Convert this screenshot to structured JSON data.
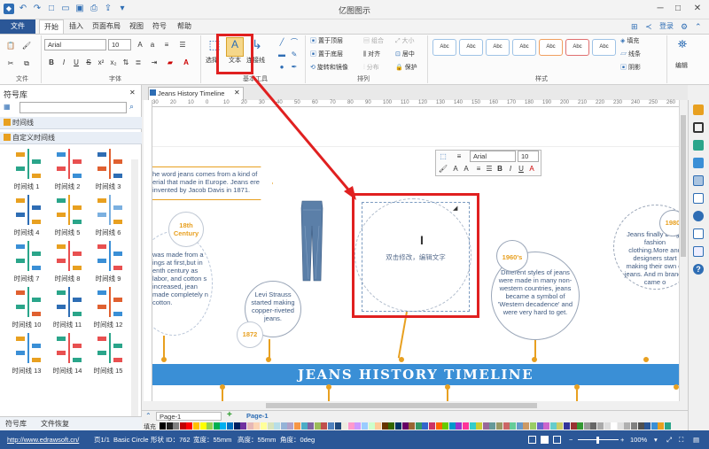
{
  "app": {
    "title": "亿图图示"
  },
  "menu": {
    "file": "文件",
    "tabs": [
      "开始",
      "插入",
      "页面布局",
      "视图",
      "符号",
      "帮助"
    ],
    "login": "登录"
  },
  "ribbon": {
    "font_name": "Arial",
    "font_size": "10",
    "group_file": "文件",
    "group_font": "字体",
    "group_basic": "基本工具",
    "group_arrange": "排列",
    "group_style": "样式",
    "select": "选择",
    "text": "文本",
    "connector": "连接线",
    "bring_front": "置于顶层",
    "send_back": "置于底层",
    "rotate": "旋转和镜像",
    "group": "组合",
    "align": "对齐",
    "distribute": "分布",
    "size": "大小",
    "center": "居中",
    "protect": "保护",
    "fill": "填充",
    "line": "线条",
    "shadow": "阴影",
    "edit": "编辑",
    "style_label": "Abc"
  },
  "library": {
    "title": "符号库",
    "search_placeholder": "",
    "cat1": "时间线",
    "cat2": "自定义时间线",
    "items": [
      "时间线 1",
      "时间线 2",
      "时间线 3",
      "时间线 4",
      "时间线 5",
      "时间线 6",
      "时间线 7",
      "时间线 8",
      "时间线 9",
      "时间线 10",
      "时间线 11",
      "时间线 12",
      "时间线 13",
      "时间线 14",
      "时间线 15"
    ],
    "bottom_tabs": [
      "符号库",
      "文件恢复"
    ]
  },
  "document": {
    "tab": "Jeans History Timeline",
    "ruler": [
      "30",
      "20",
      "10",
      "0",
      "10",
      "20",
      "30",
      "40",
      "50",
      "60",
      "70",
      "80",
      "90",
      "100",
      "110",
      "120",
      "130",
      "140",
      "150",
      "160",
      "170",
      "180",
      "190",
      "200",
      "210",
      "220",
      "230",
      "240",
      "250",
      "260"
    ],
    "banner": "JEANS HISTORY TIMELINE",
    "placeholder": "双击修改，编辑文字",
    "bubbles": {
      "b1": "he word jeans comes from a kind of erial that made in Europe. Jeans ere invented by Jacob Davis in 1871.",
      "b2_label": "18th Century",
      "b2": "was made from a ings at first,but in enth century as labor, and cotton s increased, jean made completely n cotton.",
      "b3": "Levi Strauss started making copper-riveted jeans.",
      "b3_label": "1872",
      "b4_label": "1960's",
      "b4": "Different styles of jeans were made in many non-western countries, jeans became a symbol of 'Western decadence' and were very hard to get.",
      "b5_label": "1980",
      "b5": "Jeans finally b high fashion clothing.More and designers start making their own of jeans. And m brands came o"
    }
  },
  "float_toolbar": {
    "font": "Arial",
    "size": "10"
  },
  "pages": {
    "tab1": "Page-1",
    "tab2": "Page-1",
    "fill_label": "填充"
  },
  "status": {
    "url": "http://www.edrawsoft.cn/",
    "page": "页1/1",
    "shape": "Basic Circle",
    "shape_id": "形状 ID：762",
    "width": "宽度：55mm",
    "height": "高度：55mm",
    "angle": "角度：0deg",
    "zoom": "100%"
  },
  "colors": {
    "accent": "#2b5797",
    "banner": "#3a8fd6",
    "timeline": "#e8a020",
    "red": "#e02020"
  }
}
